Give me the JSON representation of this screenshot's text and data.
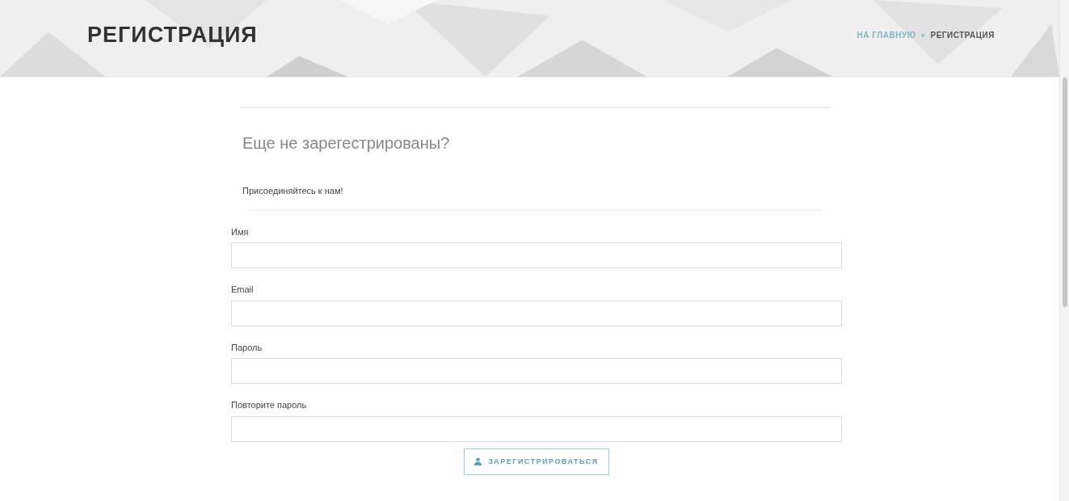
{
  "page_title": "РЕГИСТРАЦИЯ",
  "breadcrumb": [
    {
      "label": "НА ГЛАВНУЮ",
      "kind": "link"
    },
    {
      "label": "»",
      "kind": "separator"
    },
    {
      "label": "РЕГИСТРАЦИЯ",
      "kind": "current"
    }
  ],
  "heading": "Еще не зарегестрированы?",
  "subtitle": "Присоединяйтесь к нам!",
  "fields": [
    {
      "label": "Имя"
    },
    {
      "label": "Email"
    },
    {
      "label": "Пароль"
    },
    {
      "label": "Повторите пароль"
    }
  ],
  "submit_button": "ЗАРЕГИСТРИРОВАТЬСЯ"
}
